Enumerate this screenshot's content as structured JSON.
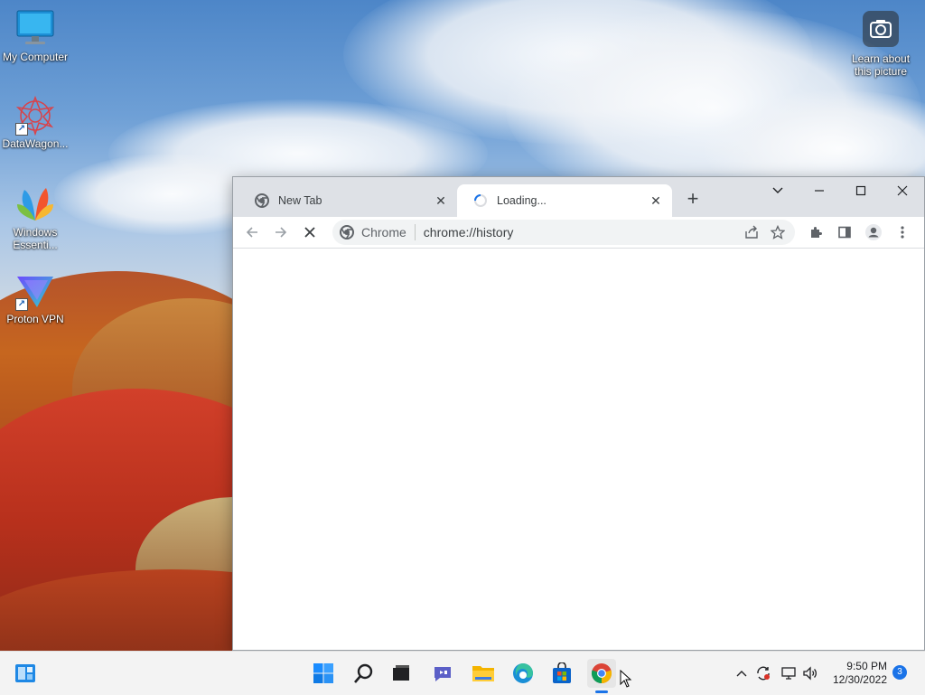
{
  "desktop": {
    "icons": [
      {
        "label": "My Computer",
        "icon": "monitor-icon"
      },
      {
        "label": "DataWagon...",
        "icon": "datawagon-icon"
      },
      {
        "label": "Windows Essenti...",
        "icon": "windows-essentials-icon"
      },
      {
        "label": "Proton VPN",
        "icon": "proton-vpn-icon"
      }
    ],
    "learn_about": {
      "label": "Learn about this picture",
      "icon": "camera-icon"
    }
  },
  "browser": {
    "tabs": [
      {
        "title": "New Tab",
        "icon": "chrome-favicon",
        "state": "inactive"
      },
      {
        "title": "Loading...",
        "icon": "loading-spinner-icon",
        "state": "active"
      }
    ],
    "omnibox": {
      "site_label": "Chrome",
      "url": "chrome://history"
    },
    "window_controls": [
      "tab-search",
      "minimize",
      "maximize",
      "close"
    ],
    "toolbar_icons": [
      "back",
      "forward",
      "stop",
      "share",
      "bookmark-star",
      "extensions",
      "side-panel",
      "profile",
      "menu"
    ]
  },
  "taskbar": {
    "apps": [
      "widgets",
      "start",
      "search",
      "task-view",
      "chat",
      "file-explorer",
      "edge",
      "store",
      "chrome"
    ],
    "active_app": "chrome",
    "tray": [
      "show-hidden-icons",
      "sync",
      "network",
      "volume"
    ],
    "time": "9:50 PM",
    "date": "12/30/2022",
    "notification_count": "3"
  },
  "colors": {
    "accent": "#1a73e8",
    "taskbar_bg": "#f3f3f3",
    "tabstrip_bg": "#dee1e6"
  }
}
